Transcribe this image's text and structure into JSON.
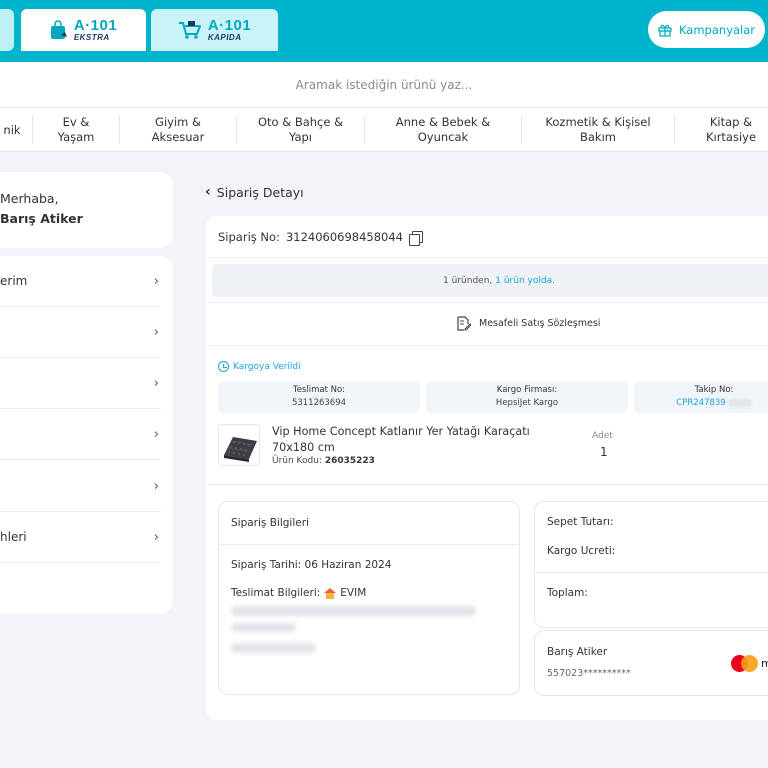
{
  "header": {
    "tabs": [
      {
        "logo_main": "A·101",
        "logo_sub": "EKSTRA"
      },
      {
        "logo_main": "A·101",
        "logo_sub": "KAPIDA"
      }
    ],
    "campaign_label": "Kampanyalar"
  },
  "search": {
    "placeholder": "Aramak istediğin ürünü yaz..."
  },
  "categories": [
    "nik",
    "Ev &\nYaşam",
    "Giyim &\nAksesuar",
    "Oto & Bahçe &\nYapı",
    "Anne & Bebek &\nOyuncak",
    "Kozmetik & Kişisel\nBakım",
    "Kitap &\nKırtasiye"
  ],
  "sidebar": {
    "greeting": "Merhaba,",
    "user_name": "Barış Atiker",
    "menu_items": [
      {
        "label": "erim"
      },
      {
        "label": ""
      },
      {
        "label": ""
      },
      {
        "label": ""
      },
      {
        "label": ""
      },
      {
        "label": "hleri"
      }
    ],
    "chevron": "›"
  },
  "main": {
    "back_label": "Sipariş Detayı",
    "order_label": "Sipariş No:",
    "order_number": "3124060698458044",
    "status_text": "1 üründen,",
    "status_link": "1 ürün yolda.",
    "contract_label": "Mesafeli Satış Sözleşmesi",
    "cargo_status": "Kargoya Verildi",
    "shipment": [
      {
        "label": "Teslimat No:",
        "value": "5311263694"
      },
      {
        "label": "Kargo Firması:",
        "value": "HepsiJet Kargo"
      },
      {
        "label": "Takip No:",
        "value": "CPR247839"
      }
    ],
    "product": {
      "title": "Vip Home Concept Katlanır Yer Yatağı Karaçatı 70x180 cm",
      "code_label": "Ürün Kodu:",
      "code": "26035223",
      "qty_label": "Adet",
      "qty": "1"
    },
    "order_info": {
      "title": "Sipariş Bilgileri",
      "date_label": "Sipariş Tarihi:",
      "date": "06 Haziran 2024",
      "delivery_label": "Teslimat Bilgileri:",
      "address_name": "EVIM"
    },
    "summary": {
      "basket_label": "Sepet Tutarı:",
      "cargo_label": "Kargo Ucreti:",
      "total_label": "Toplam:"
    },
    "payment": {
      "name": "Barış Atiker",
      "card": "557023**********",
      "brand_partial": "m"
    }
  },
  "colors": {
    "brand": "#00b4cc",
    "link": "#1aa6d6",
    "navy": "#163c66"
  }
}
